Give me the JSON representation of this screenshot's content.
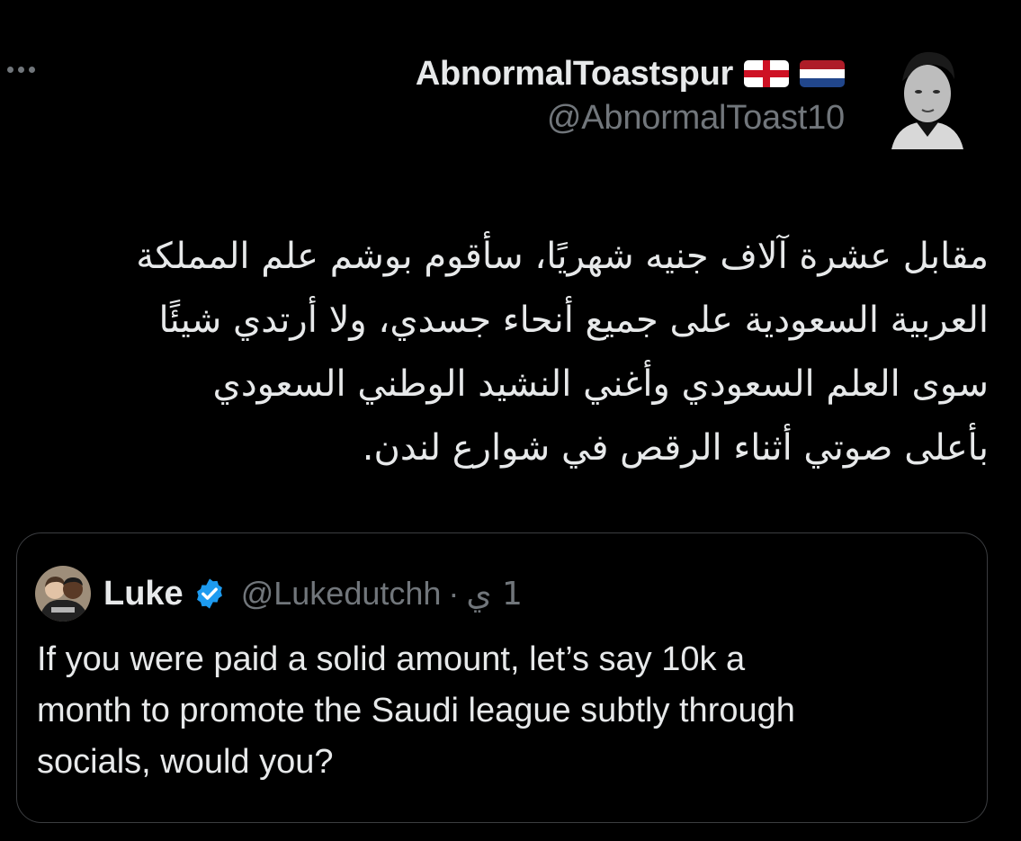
{
  "tweet": {
    "author": {
      "display_name": "AbnormalToastspur",
      "handle": "@AbnormalToast10",
      "badges": [
        "england-flag-icon",
        "netherlands-flag-icon"
      ],
      "avatar": "profile-photo"
    },
    "more_icon": "more-dots-icon",
    "text_lines": [
      "مقابل عشرة آلاف جنيه شهريًا، سأقوم بوشم علم المملكة",
      "العربية السعودية على جميع أنحاء جسدي، ولا أرتدي شيئًا",
      "سوى العلم السعودي وأغني النشيد الوطني السعودي",
      "بأعلى صوتي أثناء الرقص في شوارع لندن."
    ]
  },
  "quote": {
    "name": "Luke",
    "verified_icon": "verified-badge-icon",
    "handle": "@Lukedutchh",
    "separator": "·",
    "time": "1 ي",
    "text_lines": [
      "If you were paid a solid amount, let’s say 10k a",
      "month to promote the Saudi league subtly through",
      "socials, would you?"
    ]
  },
  "colors": {
    "background": "#000000",
    "text_primary": "#e7e9ea",
    "text_secondary": "#71767b",
    "border": "#3b3d40",
    "verified": "#1d9bf0"
  }
}
